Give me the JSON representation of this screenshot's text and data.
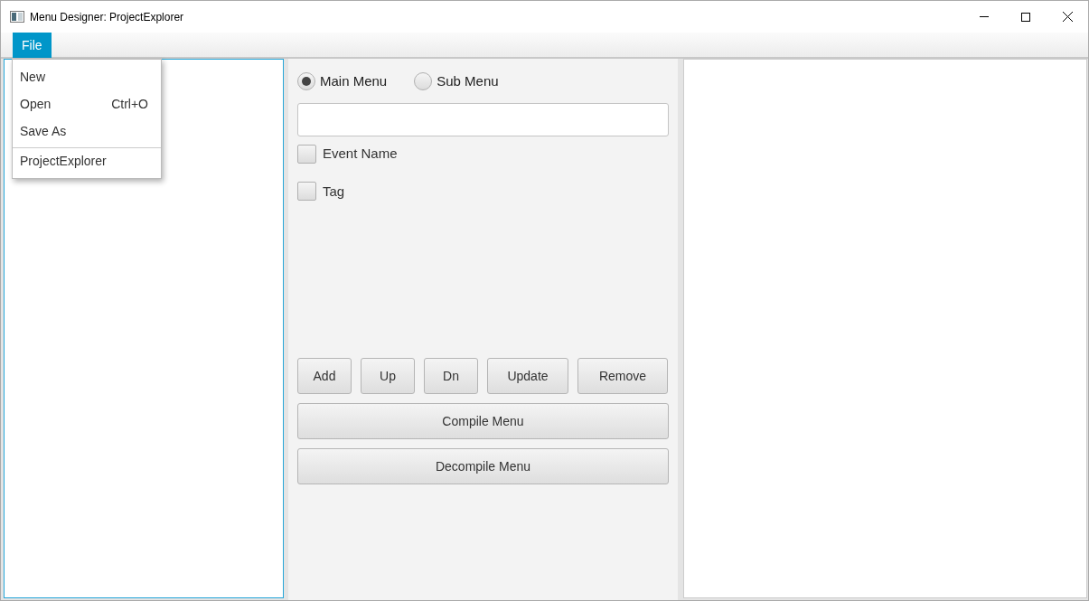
{
  "window": {
    "title": "Menu Designer: ProjectExplorer"
  },
  "menu_bar": [
    {
      "label": "File",
      "selected": true
    }
  ],
  "file_menu": [
    {
      "label": "New",
      "divider_above": false
    },
    {
      "label": "Open",
      "shortcut": "Ctrl+O",
      "divider_above": false
    },
    {
      "label": "Save As",
      "divider_above": false
    },
    {
      "label": "ProjectExplorer",
      "divider_above": true
    }
  ],
  "menu_type": [
    {
      "label": "Main Menu",
      "selected": true
    },
    {
      "label": "Sub Menu",
      "selected": false
    }
  ],
  "options": [
    {
      "label": "Event Name",
      "checked": false
    },
    {
      "label": "Tag",
      "checked": false
    }
  ],
  "row_buttons": [
    "Add",
    "Up",
    "Dn",
    "Update",
    "Remove"
  ],
  "wide_buttons": [
    "Compile Menu",
    "Decompile Menu"
  ]
}
